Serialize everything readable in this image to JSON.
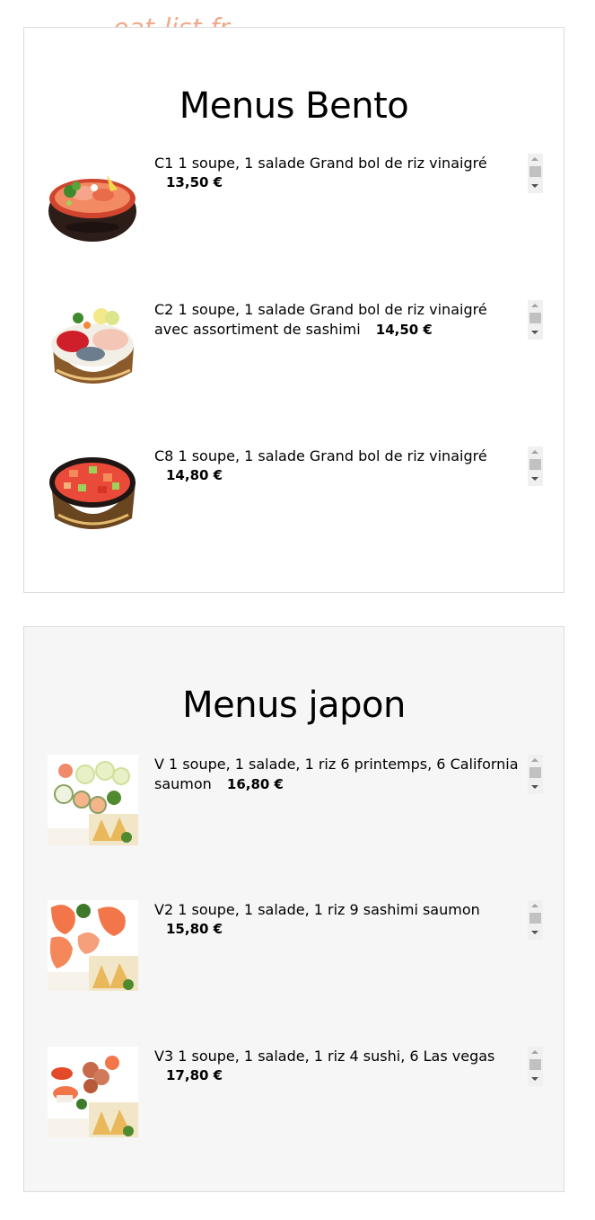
{
  "watermark": "eat-list.fr",
  "sections": [
    {
      "title": "Menus Bento",
      "items": [
        {
          "code": "C1",
          "description": "1 soupe, 1 salade Grand bol de riz vinaigré",
          "price": "13,50 €",
          "image": "chirashi-salmon-bowl"
        },
        {
          "code": "C2",
          "description": "1 soupe, 1 salade Grand bol de riz vinaigré avec assortiment de sashimi",
          "price": "14,50 €",
          "image": "chirashi-assorted-bowl"
        },
        {
          "code": "C8",
          "description": "1 soupe, 1 salade Grand bol de riz vinaigré",
          "price": "14,80 €",
          "image": "chirashi-diced-bowl"
        }
      ]
    },
    {
      "title": "Menus japon",
      "items": [
        {
          "code": "V",
          "description": "1 soupe, 1 salade, 1 riz 6 printemps, 6 California saumon",
          "price": "16,80 €",
          "image": "rolls-plate"
        },
        {
          "code": "V2",
          "description": "1 soupe, 1 salade, 1 riz 9 sashimi saumon",
          "price": "15,80 €",
          "image": "salmon-sashimi-plate"
        },
        {
          "code": "V3",
          "description": "1 soupe, 1 salade, 1 riz 4 sushi, 6 Las vegas",
          "price": "17,80 €",
          "image": "sushi-mix-plate"
        }
      ]
    }
  ],
  "colors": {
    "watermark": "#f0a98a",
    "panel_border": "#dcdcdc",
    "panel2_background": "#f6f6f6",
    "salmon": "#f07a5a",
    "bowl_dark": "#3a2a22"
  }
}
